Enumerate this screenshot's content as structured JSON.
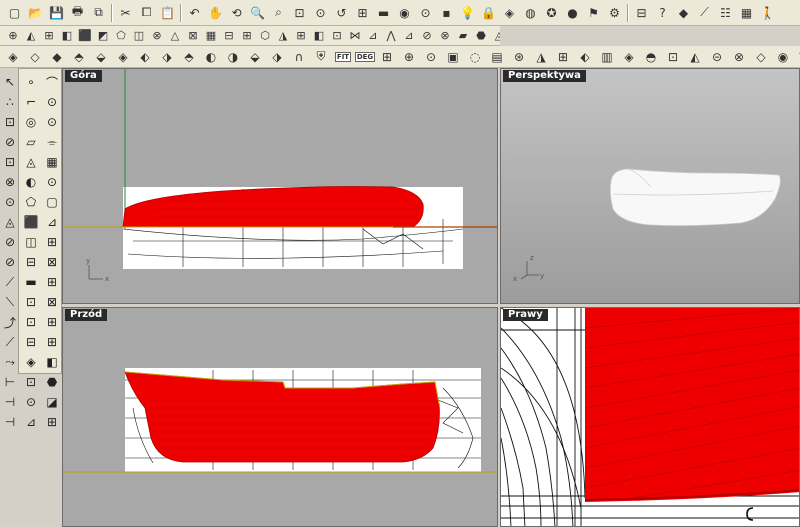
{
  "toolbar_main": {
    "icons": [
      "new-file-icon",
      "open-folder-icon",
      "save-icon",
      "print-icon",
      "import-icon",
      "cut-icon",
      "copy-icon",
      "paste-icon",
      "undo-icon",
      "pan-hand-icon",
      "rotate-view-icon",
      "zoom-icon",
      "zoom-window-icon",
      "zoom-extents-icon",
      "zoom-selected-icon",
      "undo-view-icon",
      "four-viewports-icon",
      "car-icon",
      "eye-icon",
      "point-edit-icon",
      "shade-icon",
      "light-bulb-icon",
      "lock-icon",
      "render-icon",
      "globe-icon",
      "gear-icon",
      "sphere-icon",
      "flag-icon",
      "settings-icon",
      "layers-icon",
      "help-icon",
      "blob-icon",
      "line-icon",
      "options-icon",
      "texture-icon",
      "render-person-icon"
    ],
    "glyphs": [
      "▢",
      "📂",
      "💾",
      "🖶",
      "⧉",
      "✂",
      "⧠",
      "📋",
      "↶",
      "✋",
      "⟲",
      "🔍",
      "⌕",
      "⊡",
      "⊙",
      "↺",
      "⊞",
      "▬",
      "◉",
      "⊙",
      "▪",
      "💡",
      "🔒",
      "◈",
      "◍",
      "✪",
      "●",
      "⚑",
      "⚙",
      "⊟",
      "?",
      "◆",
      "⟋",
      "☷",
      "▦",
      "🚶"
    ]
  },
  "toolbar_secondary": {
    "glyphs": [
      "⊕",
      "◭",
      "⊞",
      "◧",
      "⬛",
      "◩",
      "⬠",
      "◫",
      "⊗",
      "△",
      "⊠",
      "▦",
      "⊟",
      "⊞",
      "⬡",
      "◮",
      "⊞",
      "◧",
      "⊡",
      "⋈",
      "⊿",
      "⋀",
      "⊿",
      "⊘",
      "⊗",
      "▰",
      "⬣",
      "◬"
    ]
  },
  "toolbar_surface": {
    "fit_label": "FIT",
    "deg_label": "DEG",
    "glyphs_left": [
      "◈",
      "◇",
      "◆",
      "⬘",
      "⬙",
      "◈",
      "⬖",
      "⬗",
      "⬘",
      "◐",
      "◑",
      "⬙",
      "⬗",
      "∩",
      "⛨"
    ],
    "glyphs_right": [
      "⊞",
      "⊕",
      "⊙",
      "▣",
      "◌",
      "▤",
      "⊛",
      "◮",
      "⊞",
      "⬖",
      "▥",
      "◈",
      "◓",
      "⊡",
      "◭",
      "⊝",
      "⊗",
      "◇",
      "◉",
      "⌒",
      "◠",
      "▭",
      "⊏",
      "⊓",
      "◉",
      "⊗",
      "◓",
      "▵",
      "◠",
      "⊜",
      "⊖",
      "⬚"
    ]
  },
  "toolbox": {
    "glyphs": [
      "↖",
      "∘",
      "⌒",
      "∴",
      "⌐",
      "⊙",
      "⊡",
      "◎",
      "⊙",
      "⊘",
      "▱",
      "⌯",
      "⊡",
      "◬",
      "▦",
      "⊗",
      "◐",
      "⊙",
      "⊙",
      "⬠",
      "▢",
      "◬",
      "⬛",
      "⊿",
      "⊘",
      "◫",
      "⊞",
      "⊘",
      "⊟",
      "⊠",
      "⟋",
      "▬",
      "⊞",
      "⟍",
      "⊡",
      "⊠",
      "⤴",
      "⊡",
      "⊞",
      "⟋",
      "⊟",
      "⊞",
      "⤳",
      "◈",
      "◧",
      "⊢",
      "⊡",
      "⬣",
      "⊣",
      "⊙",
      "◪",
      "⊣",
      "⊿",
      "⊞"
    ]
  },
  "viewports": {
    "top": {
      "label": "Góra"
    },
    "perspective": {
      "label": "Perspektywa"
    },
    "front": {
      "label": "Przód"
    },
    "right": {
      "label": "Prawy"
    }
  },
  "axes": {
    "x": "x",
    "y": "y",
    "z": "z"
  }
}
